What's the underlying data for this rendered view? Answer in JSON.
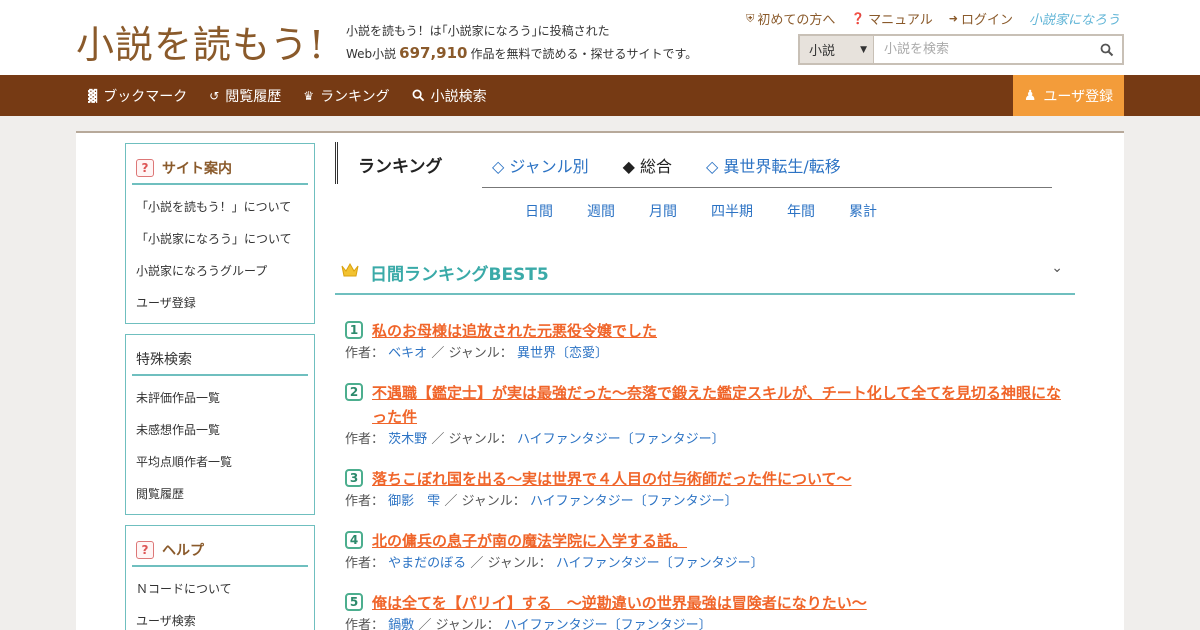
{
  "header": {
    "logo": "小説を読もう!",
    "tagline_line1": "小説を読もう！は｢小説家になろう｣に投稿された",
    "tagline_prefix": "Web小説",
    "tagline_count": "697,910",
    "tagline_suffix": "作品を無料で読める・探せるサイトです。",
    "links": [
      {
        "label": "初めての方へ",
        "icon": "shield-icon"
      },
      {
        "label": "マニュアル",
        "icon": "question-circle-icon"
      },
      {
        "label": "ログイン",
        "icon": "login-icon"
      }
    ],
    "narou_logo": "小説家になろう",
    "search": {
      "select_value": "小説",
      "placeholder": "小説を検索"
    }
  },
  "nav": {
    "items": [
      {
        "label": "ブックマーク",
        "icon": "bookmark-icon"
      },
      {
        "label": "閲覧履歴",
        "icon": "history-icon"
      },
      {
        "label": "ランキング",
        "icon": "crown-icon"
      },
      {
        "label": "小説検索",
        "icon": "search-icon"
      }
    ],
    "register_label": "ユーザ登録"
  },
  "sidebar": {
    "boxes": [
      {
        "title": "サイト案内",
        "items": [
          "「小説を読もう！」について",
          "「小説家になろう」について",
          "小説家になろうグループ",
          "ユーザ登録"
        ]
      },
      {
        "title": "特殊検索",
        "items": [
          "未評価作品一覧",
          "未感想作品一覧",
          "平均点順作者一覧",
          "閲覧履歴"
        ]
      },
      {
        "title": "ヘルプ",
        "items": [
          "Ｎコードについて",
          "ユーザ検索"
        ]
      }
    ]
  },
  "ranking": {
    "title": "ランキング",
    "tabs": [
      "◇ ジャンル別",
      "◆ 総合",
      "◇ 異世界転生/転移"
    ],
    "periods": [
      "日間",
      "週間",
      "月間",
      "四半期",
      "年間",
      "累計"
    ],
    "best_title": "日間ランキングBEST5",
    "author_label": "作者：",
    "genre_label": "／ ジャンル：",
    "items": [
      {
        "rank": "1",
        "title": "私のお母様は追放された元悪役令嬢でした",
        "author": "ベキオ",
        "genre": "異世界〔恋愛〕"
      },
      {
        "rank": "2",
        "title": "不遇職【鑑定士】が実は最強だった〜奈落で鍛えた鑑定スキルが、チート化して全てを見切る神眼になった件",
        "author": "茨木野",
        "genre": "ハイファンタジー〔ファンタジー〕"
      },
      {
        "rank": "3",
        "title": "落ちこぼれ国を出る〜実は世界で４人目の付与術師だった件について〜",
        "author": "御影　雫",
        "genre": "ハイファンタジー〔ファンタジー〕"
      },
      {
        "rank": "4",
        "title": "北の傭兵の息子が南の魔法学院に入学する話。",
        "author": "やまだのぼる",
        "genre": "ハイファンタジー〔ファンタジー〕"
      },
      {
        "rank": "5",
        "title": "俺は全てを【パリイ】する　〜逆勘違いの世界最強は冒険者になりたい〜",
        "author": "鍋敷",
        "genre": "ハイファンタジー〔ファンタジー〕"
      }
    ]
  }
}
